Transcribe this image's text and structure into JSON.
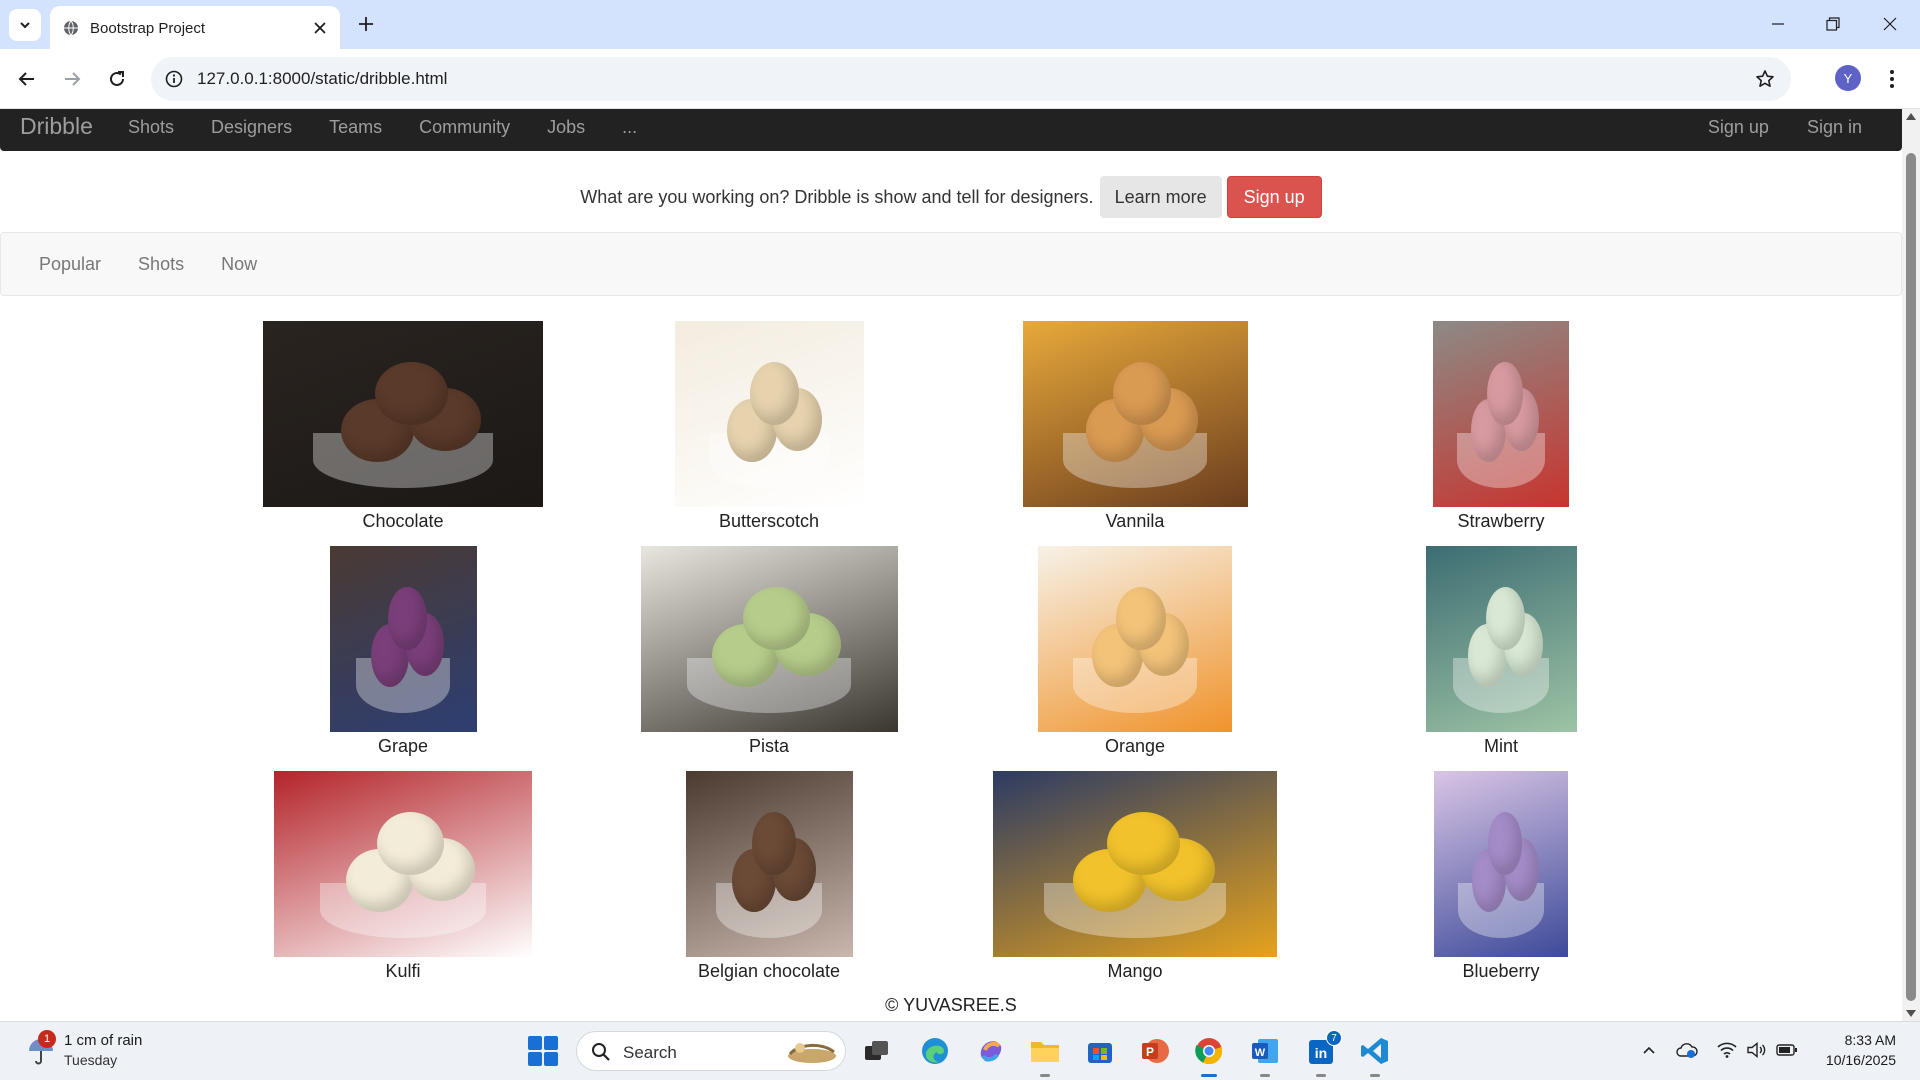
{
  "browser": {
    "tab_title": "Bootstrap Project",
    "url": "127.0.0.1:8000/static/dribble.html",
    "profile_initial": "Y"
  },
  "site": {
    "brand": "Dribble",
    "nav": [
      "Shots",
      "Designers",
      "Teams",
      "Community",
      "Jobs",
      "..."
    ],
    "nav_right": [
      "Sign up",
      "Sign in"
    ],
    "promo_text": "What are you working on? Dribble is show and tell for designers.",
    "learn_more": "Learn more",
    "sign_up": "Sign up",
    "subnav": [
      "Popular",
      "Shots",
      "Now"
    ],
    "items": [
      {
        "label": "Chocolate",
        "colors": [
          "#2a2420",
          "#5a3a2a",
          "#1b1816"
        ]
      },
      {
        "label": "Butterscotch",
        "colors": [
          "#f3ecdf",
          "#e6d2ad",
          "#ffffff"
        ]
      },
      {
        "label": "Vannila",
        "colors": [
          "#e8a93b",
          "#d99a52",
          "#6b3d1e"
        ]
      },
      {
        "label": "Strawberry",
        "colors": [
          "#8d8a86",
          "#d79aa0",
          "#c8342f"
        ]
      },
      {
        "label": "Grape",
        "colors": [
          "#4a3a33",
          "#7a3f7a",
          "#2d3e72"
        ]
      },
      {
        "label": "Pista",
        "colors": [
          "#e9e6e0",
          "#b6cc8b",
          "#3a3630"
        ]
      },
      {
        "label": "Orange",
        "colors": [
          "#f6f2e8",
          "#f3c37a",
          "#f0932b"
        ]
      },
      {
        "label": "Mint",
        "colors": [
          "#3c6d72",
          "#d8e8d4",
          "#9ec3a5"
        ]
      },
      {
        "label": "Kulfi",
        "colors": [
          "#b3242a",
          "#f3ecd8",
          "#ffffff"
        ]
      },
      {
        "label": "Belgian chocolate",
        "colors": [
          "#4a3a30",
          "#6b4a36",
          "#c9b7ad"
        ]
      },
      {
        "label": "Mango",
        "colors": [
          "#2c3b63",
          "#f1c22b",
          "#e5a31c"
        ]
      },
      {
        "label": "Blueberry",
        "colors": [
          "#d9c5e5",
          "#a48cc8",
          "#3d4a99"
        ]
      }
    ],
    "credit": "© YUVASREE.S"
  },
  "taskbar": {
    "weather_badge": "1",
    "weather_line1": "1 cm of rain",
    "weather_line2": "Tuesday",
    "search_label": "Search",
    "linkedin_badge": "7",
    "time": "8:33 AM",
    "date": "10/16/2025"
  },
  "colors": {
    "navbar": "#222222",
    "signup_button": "#d9534f",
    "tabbar": "#d3e3fd"
  }
}
